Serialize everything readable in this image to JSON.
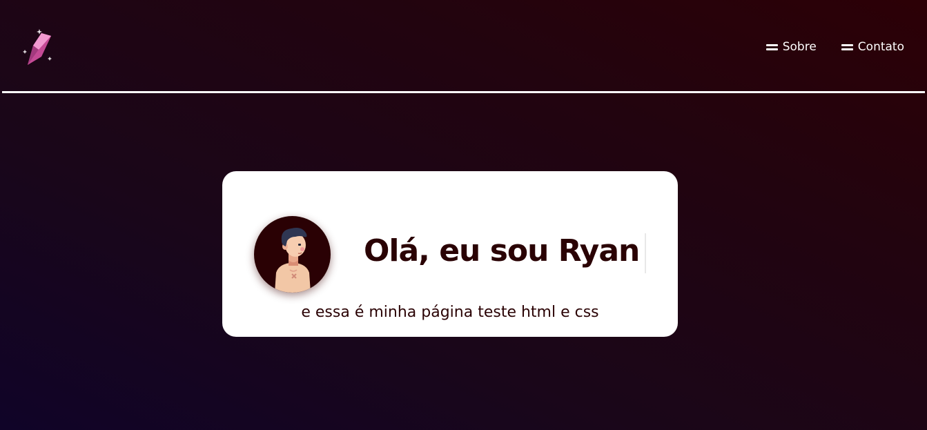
{
  "header": {
    "logo_icon": "crystal-icon",
    "nav": [
      {
        "label": "Sobre",
        "icon": "menu-icon"
      },
      {
        "label": "Contato",
        "icon": "menu-icon"
      }
    ]
  },
  "card": {
    "greeting": "Olá, eu sou Ryan",
    "subtitle": "e essa é minha página teste html e css",
    "avatar_icon": "avatar-illustration"
  },
  "colors": {
    "accent": "#2a0204",
    "crystal": "#e070b8",
    "background_start": "#100428",
    "background_end": "#2c0006"
  }
}
